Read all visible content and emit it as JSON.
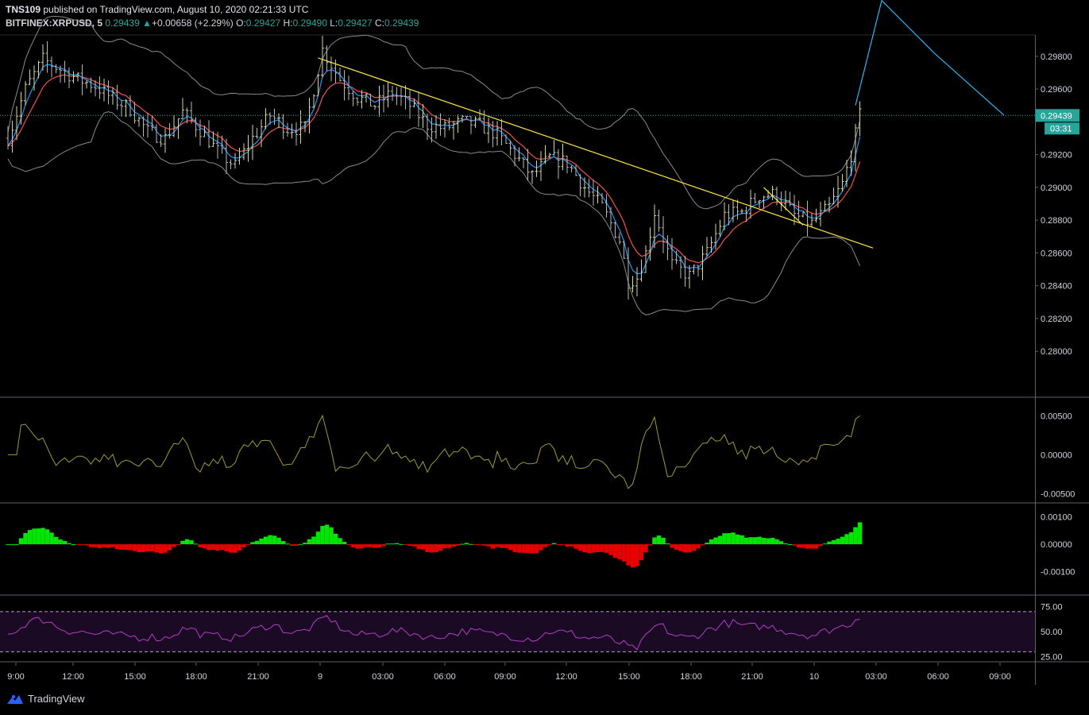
{
  "header": {
    "publisher": "TNS109",
    "published_text": "published on TradingView.com, August 10, 2020 02:21:33 UTC",
    "symbol": "BITFINEX:XRPUSD, 5",
    "last": "0.29439",
    "change": "+0.00658 (+2.29%)",
    "o_label": "O:",
    "o_value": "0.29427",
    "h_label": "H:",
    "h_value": "0.29490",
    "l_label": "L:",
    "l_value": "0.29427",
    "c_label": "C:",
    "c_value": "0.29439"
  },
  "footer": {
    "brand": "TradingView",
    "logo_icon": "tradingview-logo-icon"
  },
  "colors": {
    "up": "#26a69a",
    "bg": "#000000",
    "trend": "#ffeb3b",
    "projection": "#29b6f6",
    "bb": "#8a8a8a",
    "ema_fast": "#2196f3",
    "ema_slow": "#ef5350",
    "osc": "#9e9a35",
    "hist_up": "#00e600",
    "hist_down": "#e60000",
    "rsi": "#b23ec4"
  },
  "chart_data": [
    {
      "type": "candlestick",
      "name": "BITFINEX:XRPUSD, 5",
      "x_tick_labels": [
        "9:00",
        "12:00",
        "15:00",
        "18:00",
        "21:00",
        "9",
        "03:00",
        "06:00",
        "09:00",
        "12:00",
        "15:00",
        "18:00",
        "21:00",
        "10",
        "03:00",
        "06:00",
        "09:00"
      ],
      "y_tick_labels": [
        "0.29800",
        "0.29600",
        "0.29200",
        "0.29000",
        "0.28800",
        "0.28600",
        "0.28400",
        "0.28200",
        "0.28000"
      ],
      "ylim": [
        0.2772,
        0.2993
      ],
      "last_price_label": "0.29439",
      "countdown_label": "03:31",
      "close_path": [
        [
          0,
          0.293
        ],
        [
          4,
          0.296
        ],
        [
          8,
          0.2978
        ],
        [
          12,
          0.2972
        ],
        [
          16,
          0.2966
        ],
        [
          20,
          0.2962
        ],
        [
          24,
          0.2954
        ],
        [
          28,
          0.2948
        ],
        [
          32,
          0.2934
        ],
        [
          36,
          0.293
        ],
        [
          40,
          0.2946
        ],
        [
          44,
          0.2935
        ],
        [
          48,
          0.2922
        ],
        [
          52,
          0.2913
        ],
        [
          56,
          0.293
        ],
        [
          60,
          0.2944
        ],
        [
          64,
          0.2936
        ],
        [
          68,
          0.2936
        ],
        [
          72,
          0.2984
        ],
        [
          76,
          0.2966
        ],
        [
          80,
          0.2955
        ],
        [
          84,
          0.295
        ],
        [
          88,
          0.2958
        ],
        [
          92,
          0.295
        ],
        [
          96,
          0.2938
        ],
        [
          100,
          0.2936
        ],
        [
          104,
          0.294
        ],
        [
          108,
          0.2938
        ],
        [
          112,
          0.2932
        ],
        [
          116,
          0.292
        ],
        [
          120,
          0.2907
        ],
        [
          124,
          0.2918
        ],
        [
          128,
          0.2915
        ],
        [
          132,
          0.29
        ],
        [
          136,
          0.2888
        ],
        [
          140,
          0.2868
        ],
        [
          142,
          0.2843
        ],
        [
          144,
          0.2845
        ],
        [
          146,
          0.286
        ],
        [
          148,
          0.2885
        ],
        [
          152,
          0.2853
        ],
        [
          156,
          0.2846
        ],
        [
          160,
          0.286
        ],
        [
          164,
          0.2883
        ],
        [
          168,
          0.2885
        ],
        [
          172,
          0.2895
        ],
        [
          176,
          0.2896
        ],
        [
          180,
          0.2883
        ],
        [
          184,
          0.2878
        ],
        [
          188,
          0.2888
        ],
        [
          191,
          0.2902
        ],
        [
          193,
          0.292
        ],
        [
          195,
          0.2944
        ]
      ],
      "x_max_bar": 228,
      "trendlines": [
        {
          "name": "yellow-trendline",
          "from": [
            71,
            0.2979
          ],
          "to": [
            198,
            0.2863
          ]
        },
        {
          "name": "yellow-short-trendline",
          "from": [
            173,
            0.29
          ],
          "to": [
            182,
            0.2877
          ]
        },
        {
          "name": "blue-projection",
          "points": [
            [
              194,
              0.295
            ],
            [
              200,
              0.3014
            ],
            [
              212,
              0.2982
            ],
            [
              228,
              0.2944
            ]
          ]
        }
      ],
      "indicators": [
        "Bollinger Bands",
        "EMA fast",
        "EMA slow"
      ]
    },
    {
      "type": "line",
      "name": "oscillator",
      "y_tick_labels": [
        "0.00500",
        "0.00000",
        "-0.00500"
      ],
      "ylim": [
        -0.0062,
        0.0072
      ],
      "x_tick_labels": []
    },
    {
      "type": "bar",
      "name": "histogram",
      "y_tick_labels": [
        "0.00100",
        "0.00000",
        "-0.00100"
      ],
      "ylim": [
        -0.00185,
        0.00145
      ],
      "x_tick_labels": []
    },
    {
      "type": "line",
      "name": "RSI",
      "y_tick_labels": [
        "75.00",
        "50.00",
        "25.00"
      ],
      "ylim": [
        20,
        85
      ],
      "levels": [
        70,
        30
      ],
      "x_tick_labels": []
    }
  ]
}
